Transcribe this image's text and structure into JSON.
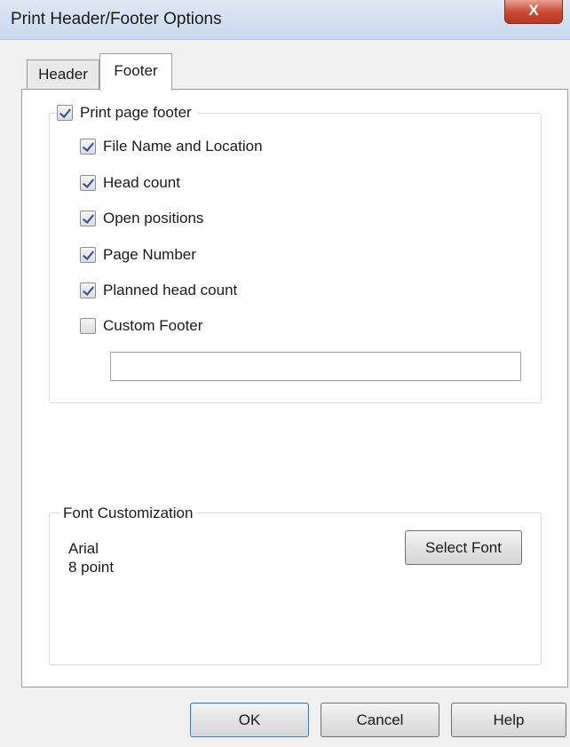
{
  "window": {
    "title": "Print Header/Footer Options",
    "close_label": "X"
  },
  "tabs": [
    {
      "label": "Header",
      "active": false
    },
    {
      "label": "Footer",
      "active": true
    }
  ],
  "footer_group": {
    "print_page_footer": {
      "label": "Print page footer",
      "checked": true
    },
    "options": [
      {
        "label": "File Name and Location",
        "checked": true
      },
      {
        "label": "Head count",
        "checked": true
      },
      {
        "label": "Open positions",
        "checked": true
      },
      {
        "label": "Page Number",
        "checked": true
      },
      {
        "label": "Planned head count",
        "checked": true
      },
      {
        "label": "Custom Footer",
        "checked": false
      }
    ],
    "custom_footer_value": ""
  },
  "font_group": {
    "legend": "Font Customization",
    "font_name": "Arial",
    "font_size": "8 point",
    "select_button": "Select Font"
  },
  "buttons": {
    "ok": "OK",
    "cancel": "Cancel",
    "help": "Help"
  }
}
